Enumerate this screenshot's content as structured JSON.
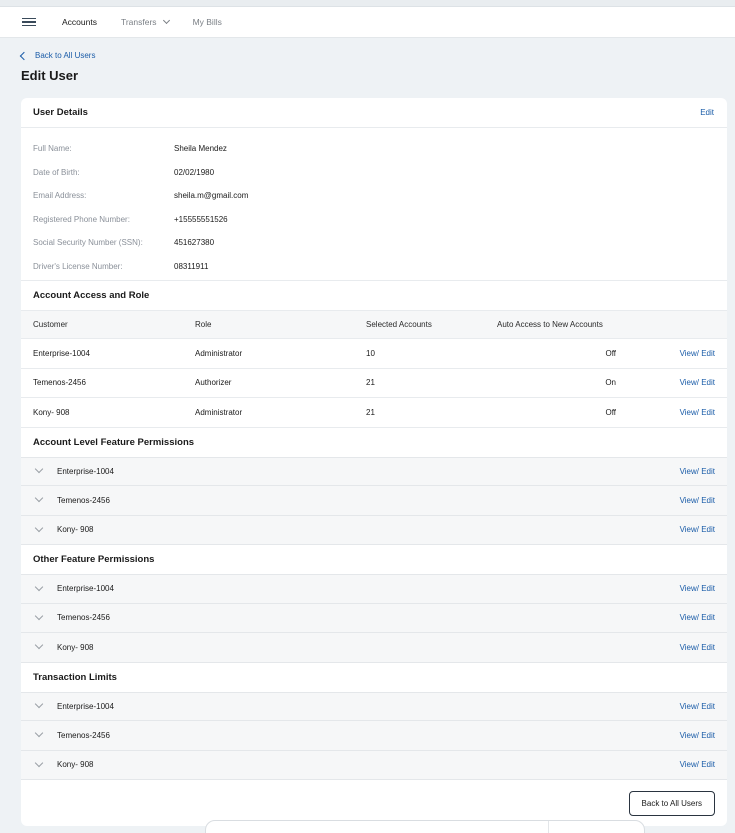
{
  "nav": {
    "items": [
      {
        "label": "Accounts"
      },
      {
        "label": "Transfers"
      },
      {
        "label": "My Bills"
      }
    ]
  },
  "back_link": "Back to All Users",
  "page_title": "Edit User",
  "user_details": {
    "title": "User Details",
    "edit_label": "Edit",
    "fields": [
      {
        "label": "Full Name:",
        "value": "Sheila Mendez"
      },
      {
        "label": "Date of Birth:",
        "value": "02/02/1980"
      },
      {
        "label": "Email Address:",
        "value": "sheila.m@gmail.com"
      },
      {
        "label": "Registered Phone Number:",
        "value": "+15555551526"
      },
      {
        "label": "Social Security Number (SSN):",
        "value": "451627380"
      },
      {
        "label": "Driver's License Number:",
        "value": "08311911"
      }
    ]
  },
  "access": {
    "title": "Account Access and Role",
    "columns": [
      "Customer",
      "Role",
      "Selected Accounts",
      "Auto Access to New Accounts"
    ],
    "rows": [
      {
        "customer": "Enterprise-1004",
        "role": "Administrator",
        "selected": "10",
        "auto": "Off",
        "action": "View/ Edit"
      },
      {
        "customer": "Temenos-2456",
        "role": "Authorizer",
        "selected": "21",
        "auto": "On",
        "action": "View/ Edit"
      },
      {
        "customer": "Kony- 908",
        "role": "Administrator",
        "selected": "21",
        "auto": "Off",
        "action": "View/ Edit"
      }
    ]
  },
  "sections": [
    {
      "title": "Account Level Feature Permissions",
      "rows": [
        {
          "name": "Enterprise-1004",
          "action": "View/ Edit"
        },
        {
          "name": "Temenos-2456",
          "action": "View/ Edit"
        },
        {
          "name": "Kony- 908",
          "action": "View/ Edit"
        }
      ]
    },
    {
      "title": "Other Feature Permissions",
      "rows": [
        {
          "name": "Enterprise-1004",
          "action": "View/ Edit"
        },
        {
          "name": "Temenos-2456",
          "action": "View/ Edit"
        },
        {
          "name": "Kony- 908",
          "action": "View/ Edit"
        }
      ]
    },
    {
      "title": "Transaction Limits",
      "rows": [
        {
          "name": "Enterprise-1004",
          "action": "View/ Edit"
        },
        {
          "name": "Temenos-2456",
          "action": "View/ Edit"
        },
        {
          "name": "Kony- 908",
          "action": "View/ Edit"
        }
      ]
    }
  ],
  "footer_button": "Back to All Users",
  "colors": {
    "accent": "#1a5ca8",
    "background": "#eef2f5"
  }
}
